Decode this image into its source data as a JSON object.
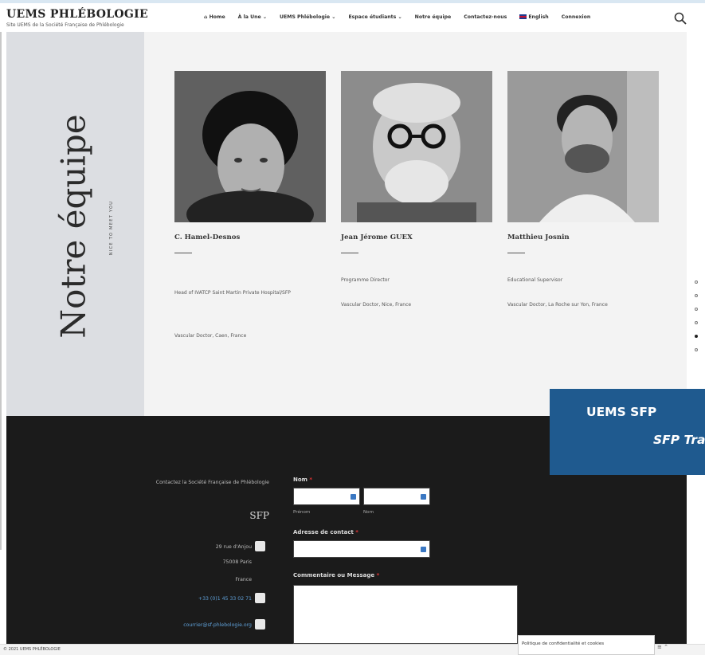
{
  "header": {
    "brand_title": "UEMS PHLÉBOLOGIE",
    "brand_tagline": "Site UEMS de la Société Française de Phlébologie",
    "nav": [
      {
        "label": "⌂ Home"
      },
      {
        "label": "À la Une ⌄"
      },
      {
        "label": "UEMS Phlébologie ⌄"
      },
      {
        "label": "Espace étudiants ⌄"
      },
      {
        "label": "Notre équipe"
      },
      {
        "label": "Contactez-nous"
      },
      {
        "label": "English"
      },
      {
        "label": "Connexion"
      }
    ],
    "search_icon": "search-icon"
  },
  "team": {
    "title": "Notre équipe",
    "subtitle": "NICE TO MEET YOU",
    "members": [
      {
        "name": "C. Hamel-Desnos",
        "line1": "Head of IVATCP Saint Martin Private Hospital/SFP",
        "line2": "Vascular Doctor, Caen, France"
      },
      {
        "name": "Jean Jérome GUEX",
        "line1": "Programme Director",
        "line2": "Vascular Doctor, Nice, France"
      },
      {
        "name": "Matthieu Josnin",
        "line1": "Educational Supervisor",
        "line2": "Vascular Doctor, La Roche sur Yon, France"
      }
    ],
    "slider_dots": 6,
    "active_dot": 5
  },
  "footer": {
    "contact_intro": "Contactez la Société Française de Phlébologie",
    "org": "SFP",
    "address1": "29 rue d'Anjou",
    "address2": "75008 Paris",
    "address3": "France",
    "phone": "+33 (0)1 45 33 02 71",
    "email": "courrier@sf-phlebologie.org",
    "form": {
      "name_label": "Nom",
      "first_label": "Prénom",
      "last_label": "Nom",
      "email_label": "Adresse de contact",
      "message_label": "Commentaire ou Message",
      "required_mark": "*"
    },
    "copyright": "© 2021 UEMS PHLÉBOLOGIE",
    "privacy": "Politique de confidentialité et cookies"
  },
  "banner": {
    "line1": "UEMS SFP",
    "line2": "SFP Tra"
  }
}
